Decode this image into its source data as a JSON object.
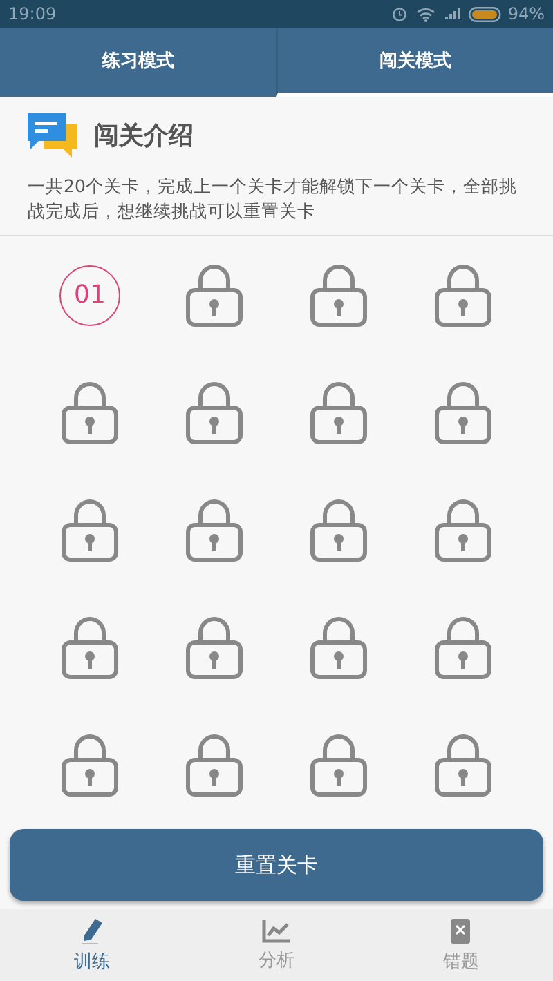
{
  "status_bar": {
    "time": "19:09",
    "battery": "94%"
  },
  "tabs": [
    {
      "label": "练习模式",
      "selected": false
    },
    {
      "label": "闯关模式",
      "selected": true
    }
  ],
  "intro": {
    "title": "闯关介绍",
    "description": "一共20个关卡，完成上一个关卡才能解锁下一个关卡，全部挑战完成后，想继续挑战可以重置关卡"
  },
  "levels": [
    {
      "locked": false,
      "label": "01"
    },
    {
      "locked": true
    },
    {
      "locked": true
    },
    {
      "locked": true
    },
    {
      "locked": true
    },
    {
      "locked": true
    },
    {
      "locked": true
    },
    {
      "locked": true
    },
    {
      "locked": true
    },
    {
      "locked": true
    },
    {
      "locked": true
    },
    {
      "locked": true
    },
    {
      "locked": true
    },
    {
      "locked": true
    },
    {
      "locked": true
    },
    {
      "locked": true
    },
    {
      "locked": true
    },
    {
      "locked": true
    },
    {
      "locked": true
    },
    {
      "locked": true
    }
  ],
  "reset_button": "重置关卡",
  "bottom_nav": [
    {
      "kind": "pencil",
      "label": "训练",
      "selected": true
    },
    {
      "kind": "chart",
      "label": "分析",
      "selected": false
    },
    {
      "kind": "book",
      "label": "错题",
      "selected": false
    }
  ]
}
